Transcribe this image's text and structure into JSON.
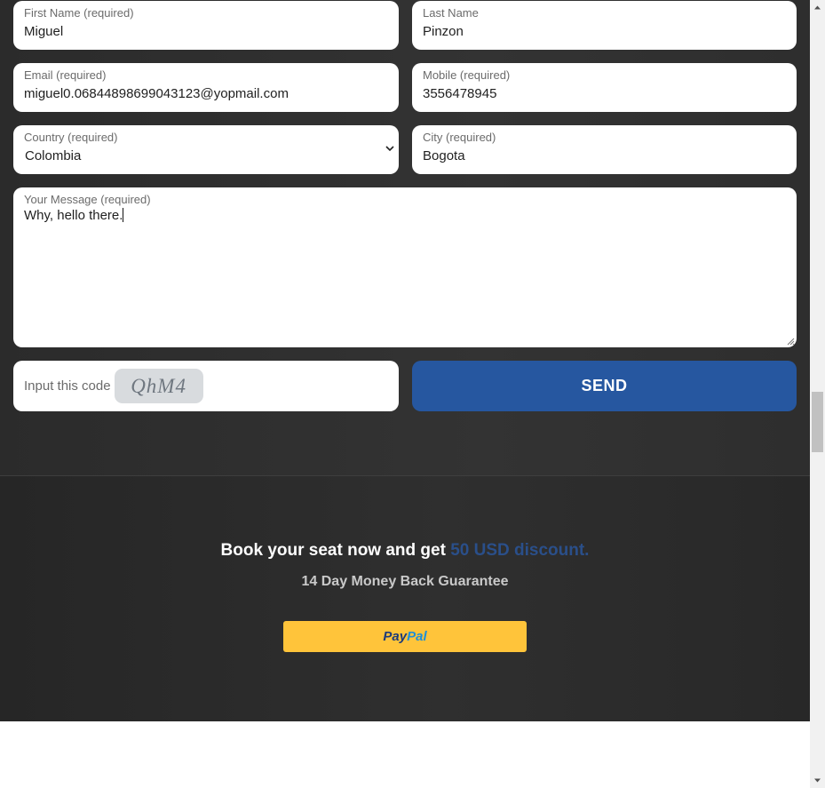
{
  "form": {
    "first_name": {
      "label": "First Name (required)",
      "value": "Miguel"
    },
    "last_name": {
      "label": "Last Name",
      "value": "Pinzon"
    },
    "email": {
      "label": "Email (required)",
      "value": "miguel0.06844898699043123@yopmail.com"
    },
    "mobile": {
      "label": "Mobile (required)",
      "value": "3556478945"
    },
    "country": {
      "label": "Country (required)",
      "value": "Colombia"
    },
    "city": {
      "label": "City (required)",
      "value": "Bogota"
    },
    "message": {
      "label": "Your Message (required)",
      "value": "Why, hello there."
    },
    "captcha": {
      "label": "Input this code",
      "code": "QhM4"
    },
    "send_label": "SEND"
  },
  "promo": {
    "headline": "Book your seat now and get ",
    "highlight": "50 USD discount.",
    "subline": "14 Day Money Back Guarantee",
    "paypal": {
      "pay": "Pay",
      "pal": "Pal"
    }
  },
  "icons": {
    "select": "chevron-down-icon",
    "resize": "resize-grip-icon",
    "scroll_up": "arrow-up-icon",
    "scroll_down": "arrow-down-icon"
  },
  "colors": {
    "send_button": "#2657a0",
    "highlight": "#2a4f8a",
    "paypal_button": "#ffc43a",
    "paypal_pay": "#1d3b7a",
    "paypal_pal": "#1f8fd6"
  }
}
